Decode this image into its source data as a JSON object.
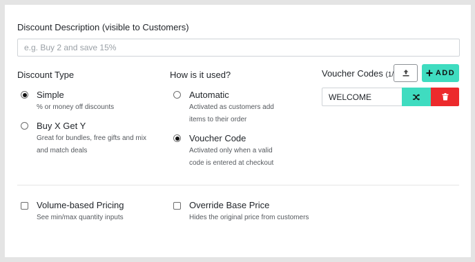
{
  "description": {
    "label": "Discount Description (visible to Customers)",
    "placeholder": "e.g. Buy 2 and save 15%",
    "value": ""
  },
  "discount_type": {
    "title": "Discount Type",
    "options": [
      {
        "label": "Simple",
        "help": "% or money off discounts",
        "checked": true
      },
      {
        "label": "Buy X Get Y",
        "help_lines": [
          "Great for bundles, free gifts and mix",
          "and match deals"
        ],
        "checked": false
      }
    ]
  },
  "usage": {
    "title": "How is it used?",
    "options": [
      {
        "label": "Automatic",
        "help_lines": [
          "Activated as customers add",
          "items to their order"
        ],
        "checked": false
      },
      {
        "label": "Voucher Code",
        "help_lines": [
          "Activated only when a valid",
          "code is entered at checkout"
        ],
        "checked": true
      }
    ]
  },
  "voucher": {
    "title": "Voucher Codes",
    "count": "(1/5)",
    "add_label": "ADD",
    "codes": [
      {
        "value": "WELCOME"
      }
    ],
    "icons": {
      "upload": "upload-icon",
      "add": "plus-icon",
      "shuffle": "shuffle-icon",
      "delete": "trash-icon"
    },
    "colors": {
      "accent": "#3fdcc0",
      "danger": "#ec2a2c"
    }
  },
  "extras": [
    {
      "label": "Volume-based Pricing",
      "help": "See min/max quantity inputs",
      "checked": false
    },
    {
      "label": "Override Base Price",
      "help": "Hides the original price from customers",
      "checked": false
    }
  ]
}
